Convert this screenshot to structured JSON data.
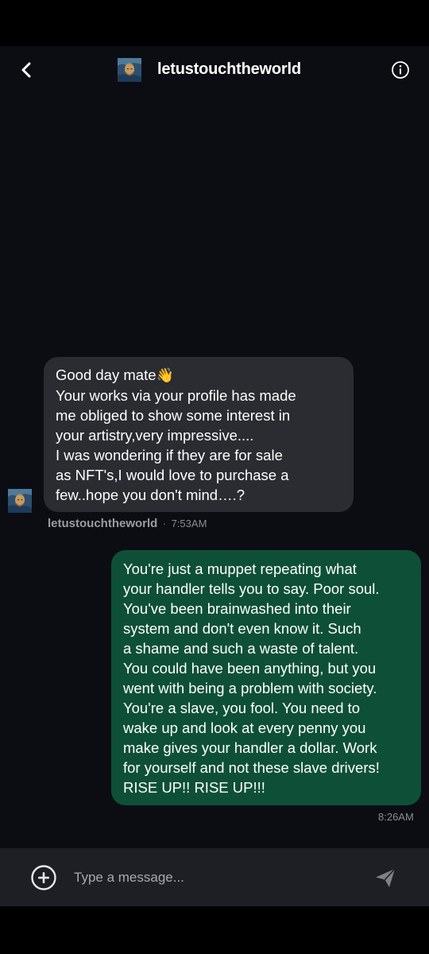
{
  "header": {
    "title": "letustouchtheworld",
    "back_icon": "chevron-left-icon",
    "info_icon": "info-circle-icon"
  },
  "messages": {
    "incoming": {
      "lines": [
        "Good day mate",
        "Your works via your profile has made",
        "me obliged to show some interest in",
        "your artistry,very impressive....",
        "I was wondering if they are for sale",
        "as NFT's,I would love to purchase a",
        "few..hope you don't mind….?"
      ],
      "emoji": "👋",
      "sender": "letustouchtheworld",
      "separator": "·",
      "time": "7:53AM"
    },
    "outgoing": {
      "lines": [
        "You're just a muppet repeating what",
        "your handler tells you to say. Poor soul.",
        "You've been brainwashed into their",
        "system and don't even know it. Such",
        "a shame and such a waste of talent.",
        "You could have been anything, but you",
        "went with being a problem with society.",
        "You're a slave, you fool. You need to",
        "wake up and look at every penny you",
        "make gives your handler a dollar. Work",
        "for yourself and not these slave drivers!",
        "RISE UP!! RISE UP!!!"
      ],
      "time": "8:26AM"
    }
  },
  "composer": {
    "placeholder": "Type a message...",
    "add_icon": "plus-circle-icon",
    "send_icon": "send-icon"
  },
  "colors": {
    "background": "#0b0d12",
    "incoming_bubble": "#2a2c31",
    "outgoing_bubble": "#0e5037",
    "composer": "#1d1f24"
  }
}
